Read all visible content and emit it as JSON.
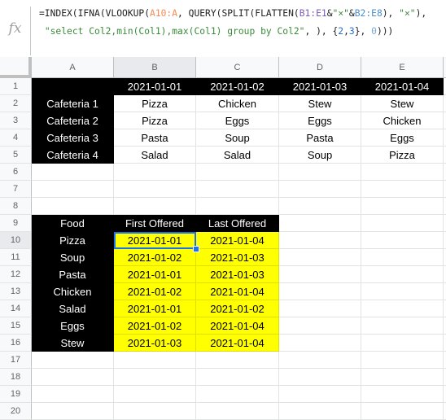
{
  "formula_bar": {
    "icon": "fx-icon",
    "icon_text": "fx",
    "formula_line1_parts": [
      {
        "t": "=INDEX(IFNA(VLOOKUP(",
        "c": ""
      },
      {
        "t": "A10:A",
        "c": "ref-a"
      },
      {
        "t": ", QUERY(SPLIT(FLATTEN(",
        "c": ""
      },
      {
        "t": "B1:E1",
        "c": "ref-b"
      },
      {
        "t": "&",
        "c": ""
      },
      {
        "t": "\"×\"",
        "c": "str"
      },
      {
        "t": "&",
        "c": ""
      },
      {
        "t": "B2:E8",
        "c": "ref-c"
      },
      {
        "t": "), ",
        "c": ""
      },
      {
        "t": "\"×\"",
        "c": "str"
      },
      {
        "t": "),",
        "c": ""
      }
    ],
    "formula_line2_parts": [
      {
        "t": " ",
        "c": ""
      },
      {
        "t": "\"select Col2,min(Col1),max(Col1) group by Col2\"",
        "c": "str"
      },
      {
        "t": ", ), {",
        "c": ""
      },
      {
        "t": "2",
        "c": "num"
      },
      {
        "t": ",",
        "c": ""
      },
      {
        "t": "3",
        "c": "num"
      },
      {
        "t": "}, ",
        "c": ""
      },
      {
        "t": "0",
        "c": "num0"
      },
      {
        "t": ")))",
        "c": ""
      }
    ]
  },
  "sheet": {
    "columns": [
      "A",
      "B",
      "C",
      "D",
      "E"
    ],
    "row_numbers": [
      "1",
      "2",
      "3",
      "4",
      "5",
      "6",
      "7",
      "8",
      "9",
      "10",
      "11",
      "12",
      "13",
      "14",
      "15",
      "16",
      "17",
      "18",
      "19",
      "20"
    ],
    "selected_cell": "B10",
    "rows": [
      [
        "",
        "2021-01-01",
        "2021-01-02",
        "2021-01-03",
        "2021-01-04"
      ],
      [
        "Cafeteria 1",
        "Pizza",
        "Chicken",
        "Stew",
        "Stew"
      ],
      [
        "Cafeteria 2",
        "Pizza",
        "Eggs",
        "Eggs",
        "Chicken"
      ],
      [
        "Cafeteria 3",
        "Pasta",
        "Soup",
        "Pasta",
        "Eggs"
      ],
      [
        "Cafeteria 4",
        "Salad",
        "Salad",
        "Soup",
        "Pizza"
      ],
      [
        "",
        "",
        "",
        "",
        ""
      ],
      [
        "",
        "",
        "",
        "",
        ""
      ],
      [
        "",
        "",
        "",
        "",
        ""
      ],
      [
        "Food",
        "First Offered",
        "Last Offered",
        "",
        ""
      ],
      [
        "Pizza",
        "2021-01-01",
        "2021-01-04",
        "",
        ""
      ],
      [
        "Soup",
        "2021-01-02",
        "2021-01-03",
        "",
        ""
      ],
      [
        "Pasta",
        "2021-01-01",
        "2021-01-03",
        "",
        ""
      ],
      [
        "Chicken",
        "2021-01-02",
        "2021-01-04",
        "",
        ""
      ],
      [
        "Salad",
        "2021-01-01",
        "2021-01-02",
        "",
        ""
      ],
      [
        "Eggs",
        "2021-01-02",
        "2021-01-04",
        "",
        ""
      ],
      [
        "Stew",
        "2021-01-03",
        "2021-01-04",
        "",
        ""
      ],
      [
        "",
        "",
        "",
        "",
        ""
      ],
      [
        "",
        "",
        "",
        "",
        ""
      ],
      [
        "",
        "",
        "",
        "",
        ""
      ],
      [
        "",
        "",
        "",
        "",
        ""
      ]
    ]
  },
  "colors": {
    "header_fill": "#000000",
    "result_fill": "#ffff00",
    "selection": "#1a73e8"
  }
}
